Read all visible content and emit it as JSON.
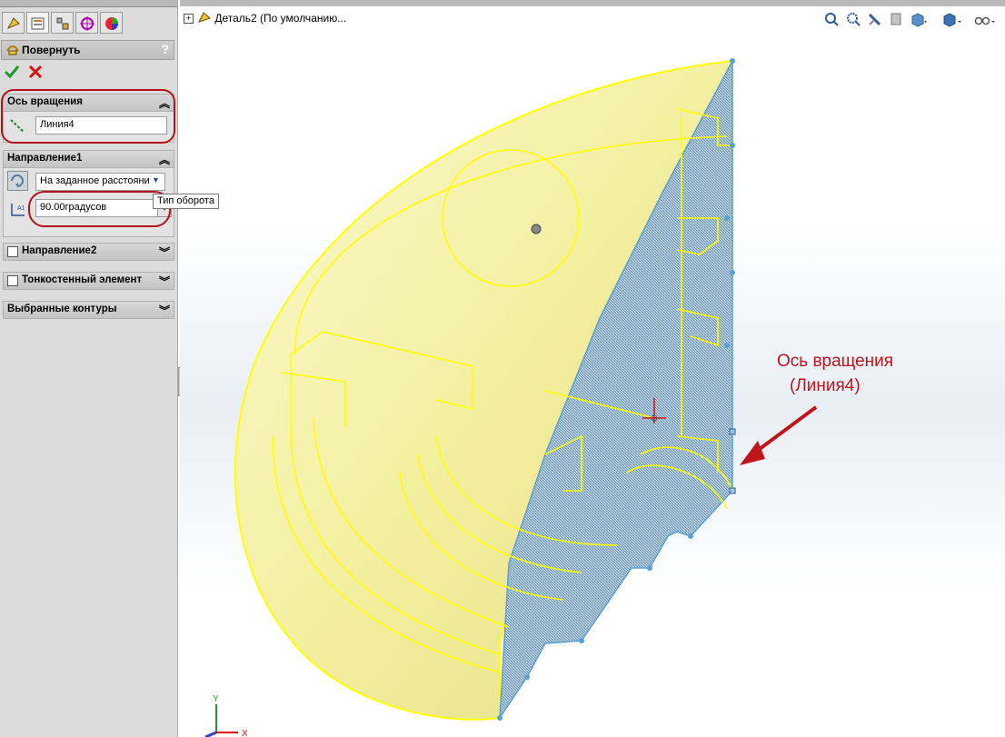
{
  "tree": {
    "label": "Деталь2  (По умолчанию..."
  },
  "property_manager": {
    "title": "Повернуть",
    "help": "?",
    "axis_group": {
      "title": "Ось вращения",
      "value": "Линия4"
    },
    "direction1": {
      "title": "Направление1",
      "type_value": "На заданное расстояни",
      "angle_value": "90.00градусов",
      "tooltip": "Тип оборота"
    },
    "direction2": {
      "title": "Направление2"
    },
    "thin": {
      "title": "Тонкостенный элемент"
    },
    "contours": {
      "title": "Выбранные контуры"
    }
  },
  "annotation": {
    "line1": "Ось вращения",
    "line2": "(Линия4)"
  },
  "axes": {
    "x": "X",
    "y": "Y"
  },
  "colors": {
    "accent_red": "#c0141b",
    "model_yellow": "#ffff00",
    "model_blue": "#5aa0d8",
    "panel_bg": "#dcdcdc"
  },
  "icons": [
    "revolve-feature-icon",
    "ok-check-icon",
    "cancel-x-icon",
    "line-axis-icon",
    "reverse-direction-icon",
    "angle-icon",
    "zoom-to-fit-icon",
    "zoom-area-icon",
    "previous-view-icon",
    "section-view-icon",
    "view-orientation-icon",
    "display-style-icon",
    "hide-show-icon",
    "part-icon"
  ]
}
